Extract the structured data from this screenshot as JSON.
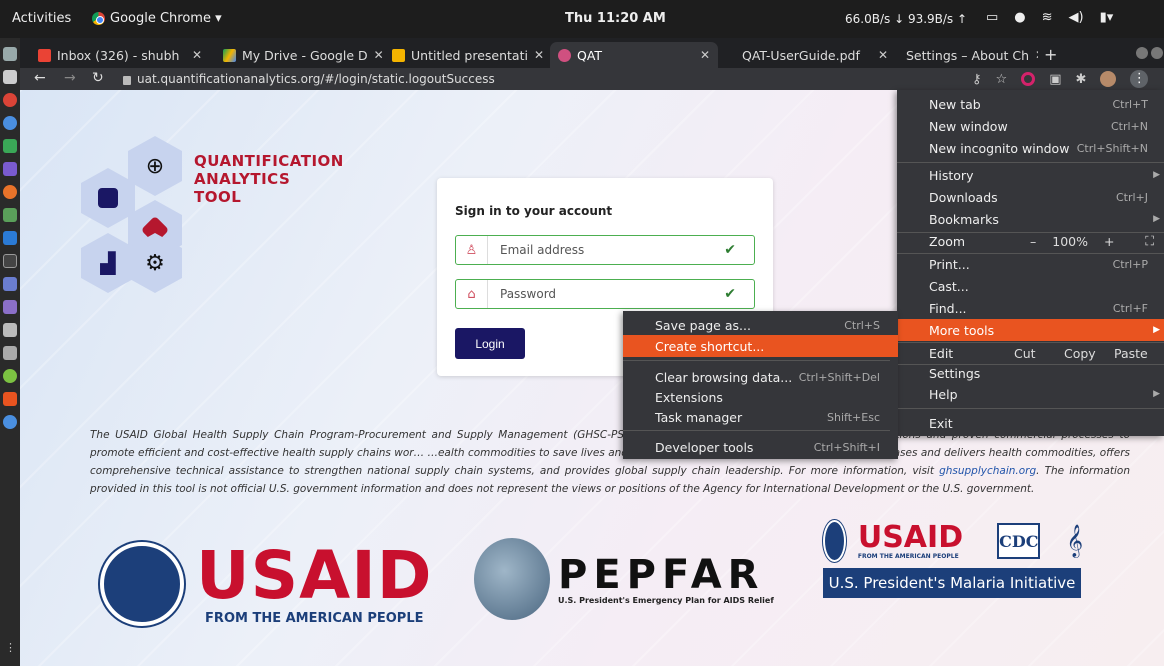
{
  "system": {
    "activities": "Activities",
    "app_name": "Google Chrome ▾",
    "clock": "Thu 11:20 AM",
    "net_down": "66.0B/s",
    "net_up": "93.9B/s"
  },
  "tabs": [
    {
      "label": "Inbox (326) - shubh",
      "active": false
    },
    {
      "label": "My Drive - Google D",
      "active": false
    },
    {
      "label": "Untitled presentati",
      "active": false
    },
    {
      "label": "QAT",
      "active": true
    },
    {
      "label": "QAT-UserGuide.pdf",
      "active": false
    },
    {
      "label": "Settings – About Ch",
      "active": false
    }
  ],
  "omnibox": {
    "url": "uat.quantificationanalytics.org/#/login/static.logoutSuccess"
  },
  "qat_logo": {
    "line1": "QUANTIFICATION",
    "line2": "ANALYTICS",
    "line3": "TOOL"
  },
  "signin": {
    "title": "Sign in to your account",
    "email_placeholder": "Email address",
    "password_placeholder": "Password",
    "login_label": "Login"
  },
  "disclaimer": {
    "part1": "The USAID Global Health Supply Chain Program-Procurement and Supply Management (GHSC-PSM) ",
    "part1_tail": "…19-0004. GHSC-PSM connects technical solutions and proven commercial processes to promote efficient and cost-effective health supply chains wor… …ealth commodities to save lives and create a healthier future for all. The project purchases and delivers health commodities, offers comprehensive technical assistance to strengthen national supply chain systems, and provides global supply chain leadership. For more information, visit ",
    "link": "ghsupplychain.org",
    "part2": ". The information provided in this tool is not official U.S. government information and does not represent the views or positions of the Agency for International Development or the U.S. government."
  },
  "logos": {
    "usaid": "USAID",
    "usaid_sub": "FROM THE AMERICAN PEOPLE",
    "pepfar": "PEPFAR",
    "pepfar_sub": "U.S. President's Emergency Plan for AIDS Relief",
    "usaid_small": "USAID",
    "usaid_small_sub": "FROM THE AMERICAN PEOPLE",
    "cdc": "CDC",
    "pmi": "U.S. President's Malaria Initiative"
  },
  "chrome_menu": {
    "new_tab": {
      "label": "New tab",
      "shortcut": "Ctrl+T"
    },
    "new_window": {
      "label": "New window",
      "shortcut": "Ctrl+N"
    },
    "incognito": {
      "label": "New incognito window",
      "shortcut": "Ctrl+Shift+N"
    },
    "history": {
      "label": "History"
    },
    "downloads": {
      "label": "Downloads",
      "shortcut": "Ctrl+J"
    },
    "bookmarks": {
      "label": "Bookmarks"
    },
    "zoom": {
      "label": "Zoom",
      "minus": "–",
      "value": "100%",
      "plus": "+"
    },
    "print": {
      "label": "Print...",
      "shortcut": "Ctrl+P"
    },
    "cast": {
      "label": "Cast..."
    },
    "find": {
      "label": "Find...",
      "shortcut": "Ctrl+F"
    },
    "more_tools": {
      "label": "More tools"
    },
    "edit": {
      "label": "Edit",
      "cut": "Cut",
      "copy": "Copy",
      "paste": "Paste"
    },
    "settings": {
      "label": "Settings"
    },
    "help": {
      "label": "Help"
    },
    "exit": {
      "label": "Exit"
    }
  },
  "more_tools_menu": {
    "save_page": {
      "label": "Save page as...",
      "shortcut": "Ctrl+S"
    },
    "create_shortcut": {
      "label": "Create shortcut..."
    },
    "clear_data": {
      "label": "Clear browsing data...",
      "shortcut": "Ctrl+Shift+Del"
    },
    "extensions": {
      "label": "Extensions"
    },
    "task_manager": {
      "label": "Task manager",
      "shortcut": "Shift+Esc"
    },
    "dev_tools": {
      "label": "Developer tools",
      "shortcut": "Ctrl+Shift+I"
    }
  },
  "colors": {
    "ubuntu_orange": "#e95420",
    "qat_red": "#b5172e",
    "login_navy": "#1a1764",
    "usaid_red": "#c8102e",
    "usaid_blue": "#1c3f7a"
  }
}
